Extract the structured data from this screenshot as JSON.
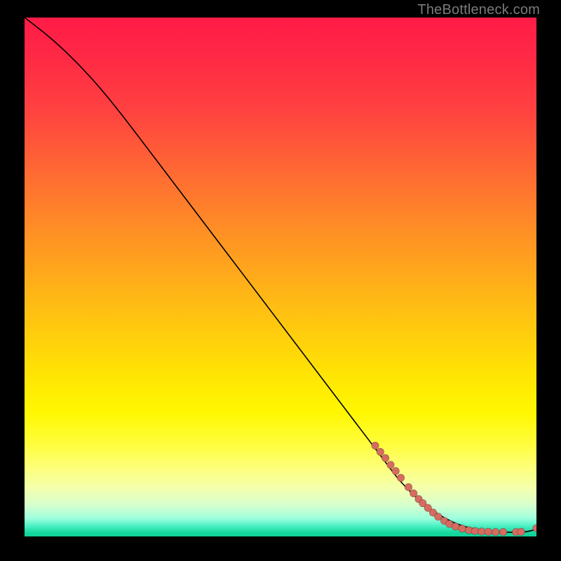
{
  "watermark": "TheBottleneck.com",
  "chart_data": {
    "type": "line",
    "title": "",
    "xlabel": "",
    "ylabel": "",
    "xlim": [
      0,
      100
    ],
    "ylim": [
      0,
      100
    ],
    "series": [
      {
        "name": "bottleneck-curve",
        "x": [
          0,
          4,
          8,
          12,
          16,
          20,
          25,
          30,
          35,
          40,
          45,
          50,
          55,
          60,
          65,
          70,
          73,
          76,
          78,
          80,
          82,
          84,
          86,
          88,
          90,
          92,
          94,
          96,
          98,
          100
        ],
        "y": [
          100,
          97,
          93.5,
          89.5,
          85,
          80,
          73.5,
          67,
          60.5,
          54,
          47.5,
          41,
          34.5,
          28,
          21.5,
          15,
          11,
          8,
          6.2,
          4.8,
          3.6,
          2.6,
          1.9,
          1.4,
          1.1,
          0.9,
          0.8,
          0.8,
          0.85,
          1.4
        ]
      }
    ],
    "marker_points": [
      {
        "x": 68.5,
        "y": 17.5
      },
      {
        "x": 69.5,
        "y": 16.3
      },
      {
        "x": 70.5,
        "y": 15.1
      },
      {
        "x": 71.5,
        "y": 13.8
      },
      {
        "x": 72.5,
        "y": 12.6
      },
      {
        "x": 73.5,
        "y": 11.3
      },
      {
        "x": 75.0,
        "y": 9.5
      },
      {
        "x": 76.0,
        "y": 8.3
      },
      {
        "x": 77.0,
        "y": 7.2
      },
      {
        "x": 77.8,
        "y": 6.4
      },
      {
        "x": 78.8,
        "y": 5.5
      },
      {
        "x": 79.8,
        "y": 4.6
      },
      {
        "x": 80.8,
        "y": 3.8
      },
      {
        "x": 82.0,
        "y": 3.0
      },
      {
        "x": 83.0,
        "y": 2.4
      },
      {
        "x": 84.2,
        "y": 1.9
      },
      {
        "x": 85.5,
        "y": 1.5
      },
      {
        "x": 86.8,
        "y": 1.2
      },
      {
        "x": 88.0,
        "y": 1.05
      },
      {
        "x": 89.3,
        "y": 0.95
      },
      {
        "x": 90.6,
        "y": 0.9
      },
      {
        "x": 92.0,
        "y": 0.85
      },
      {
        "x": 93.5,
        "y": 0.85
      },
      {
        "x": 96.0,
        "y": 0.85
      },
      {
        "x": 97.0,
        "y": 0.9
      },
      {
        "x": 100.0,
        "y": 1.6
      }
    ],
    "gradient_stops": [
      {
        "pos": 0.0,
        "color": "#ff1b47"
      },
      {
        "pos": 0.3,
        "color": "#ff6a33"
      },
      {
        "pos": 0.55,
        "color": "#ffbb14"
      },
      {
        "pos": 0.76,
        "color": "#fff700"
      },
      {
        "pos": 0.94,
        "color": "#d6ffce"
      },
      {
        "pos": 1.0,
        "color": "#0fd298"
      }
    ]
  }
}
